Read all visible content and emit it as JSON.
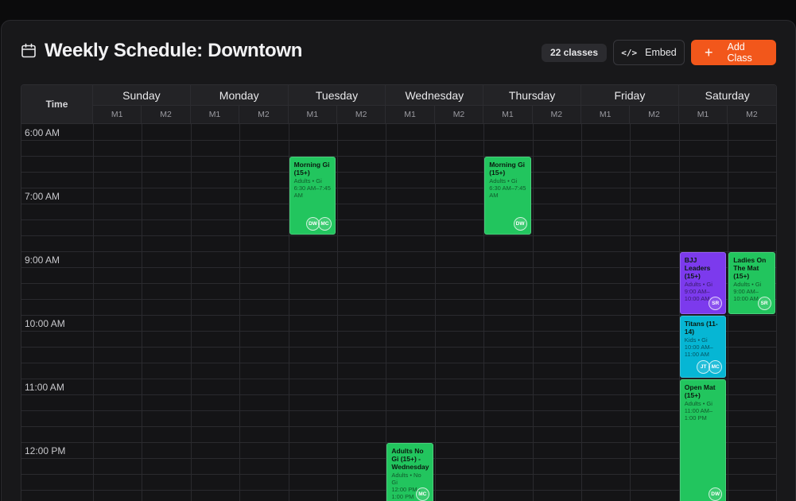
{
  "header": {
    "title": "Weekly Schedule: Downtown",
    "count_badge": "22 classes",
    "embed_label": "Embed",
    "add_label": "Add Class"
  },
  "colors": {
    "accent": "#f2571b",
    "green": "#22c55e",
    "purple": "#7c3aed",
    "cyan": "#06b6d4"
  },
  "grid": {
    "time_header": "Time",
    "days": [
      "Sunday",
      "Monday",
      "Tuesday",
      "Wednesday",
      "Thursday",
      "Friday",
      "Saturday"
    ],
    "mats": [
      "M1",
      "M2"
    ],
    "time_labels": [
      "6:00 AM",
      "7:00 AM",
      "9:00 AM",
      "10:00 AM",
      "11:00 AM",
      "12:00 PM"
    ]
  },
  "events": [
    {
      "day": 2,
      "mat": 0,
      "start": 2,
      "rows": 5,
      "color": "green",
      "title": "Morning Gi (15+)",
      "sub": "Adults • Gi",
      "time": "6:30 AM–7:45 AM",
      "instructors": [
        "DW",
        "MC"
      ]
    },
    {
      "day": 4,
      "mat": 0,
      "start": 2,
      "rows": 5,
      "color": "green",
      "title": "Morning Gi (15+)",
      "sub": "Adults • Gi",
      "time": "6:30 AM–7:45 AM",
      "instructors": [
        "DW"
      ]
    },
    {
      "day": 6,
      "mat": 0,
      "start": 8,
      "rows": 4,
      "color": "purple",
      "title": "BJJ Leaders (15+)",
      "sub": "Adults • Gi",
      "time": "9:00 AM–10:00 AM",
      "instructors": [
        "SR"
      ]
    },
    {
      "day": 6,
      "mat": 1,
      "start": 8,
      "rows": 4,
      "color": "green",
      "title": "Ladies On The Mat (15+)",
      "sub": "Adults • Gi",
      "time": "9:00 AM–10:00 AM",
      "instructors": [
        "SR"
      ]
    },
    {
      "day": 6,
      "mat": 0,
      "start": 12,
      "rows": 4,
      "color": "cyan",
      "title": "Titans (11-14)",
      "sub": "Kids • Gi",
      "time": "10:00 AM–11:00 AM",
      "instructors": [
        "JT",
        "MC"
      ]
    },
    {
      "day": 6,
      "mat": 0,
      "start": 16,
      "rows": 8,
      "color": "green",
      "title": "Open Mat (15+)",
      "sub": "Adults • Gi",
      "time": "11:00 AM–1:00 PM",
      "instructors": [
        "DW"
      ]
    },
    {
      "day": 3,
      "mat": 0,
      "start": 20,
      "rows": 4,
      "color": "green",
      "title": "Adults No Gi (15+) - Wednesday",
      "sub": "Adults • No Gi",
      "time": "12:00 PM–1:00 PM",
      "instructors": [
        "MC"
      ]
    }
  ]
}
